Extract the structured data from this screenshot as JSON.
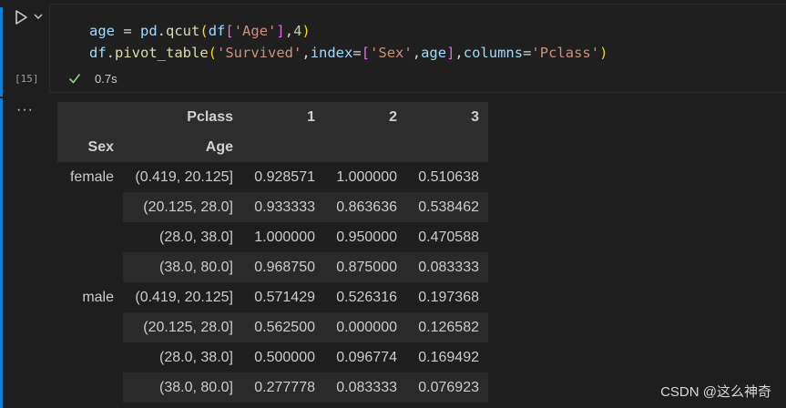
{
  "cell": {
    "execution_count": "[15]",
    "status_time": "0.7s",
    "code": {
      "line1": {
        "var": "age",
        "eq": " = ",
        "obj": "pd",
        "dot": ".",
        "fn": "qcut",
        "p1": "(",
        "df": "df",
        "b1": "[",
        "str": "'Age'",
        "b2": "]",
        "comma": ",",
        "num": "4",
        "p2": ")"
      },
      "line2": {
        "obj": "df",
        "dot": ".",
        "fn": "pivot_table",
        "p1": "(",
        "s1": "'Survived'",
        "c1": ",",
        "kw1": "index",
        "eq1": "=",
        "b1": "[",
        "s2": "'Sex'",
        "c2": ",",
        "v1": "age",
        "b2": "]",
        "c3": ",",
        "kw2": "columns",
        "eq2": "=",
        "s3": "'Pclass'",
        "p2": ")"
      }
    }
  },
  "output": {
    "more_label": "···",
    "table": {
      "col_level_name": "Pclass",
      "columns": [
        "1",
        "2",
        "3"
      ],
      "index_names": [
        "Sex",
        "Age"
      ],
      "rows": [
        {
          "sex": "female",
          "age": "(0.419, 20.125]",
          "values": [
            "0.928571",
            "1.000000",
            "0.510638"
          ]
        },
        {
          "sex": "",
          "age": "(20.125, 28.0]",
          "values": [
            "0.933333",
            "0.863636",
            "0.538462"
          ]
        },
        {
          "sex": "",
          "age": "(28.0, 38.0]",
          "values": [
            "1.000000",
            "0.950000",
            "0.470588"
          ]
        },
        {
          "sex": "",
          "age": "(38.0, 80.0]",
          "values": [
            "0.968750",
            "0.875000",
            "0.083333"
          ]
        },
        {
          "sex": "male",
          "age": "(0.419, 20.125]",
          "values": [
            "0.571429",
            "0.526316",
            "0.197368"
          ]
        },
        {
          "sex": "",
          "age": "(20.125, 28.0]",
          "values": [
            "0.562500",
            "0.000000",
            "0.126582"
          ]
        },
        {
          "sex": "",
          "age": "(28.0, 38.0]",
          "values": [
            "0.500000",
            "0.096774",
            "0.169492"
          ]
        },
        {
          "sex": "",
          "age": "(38.0, 80.0]",
          "values": [
            "0.277778",
            "0.083333",
            "0.076923"
          ]
        }
      ]
    }
  },
  "watermark": "CSDN @这么神奇",
  "colors": {
    "accent": "#0e7fd4",
    "success": "#89d185",
    "background": "#1e1e1e"
  },
  "icons": {
    "run": "play-icon",
    "run_menu": "chevron-down-icon",
    "status": "check-icon"
  }
}
